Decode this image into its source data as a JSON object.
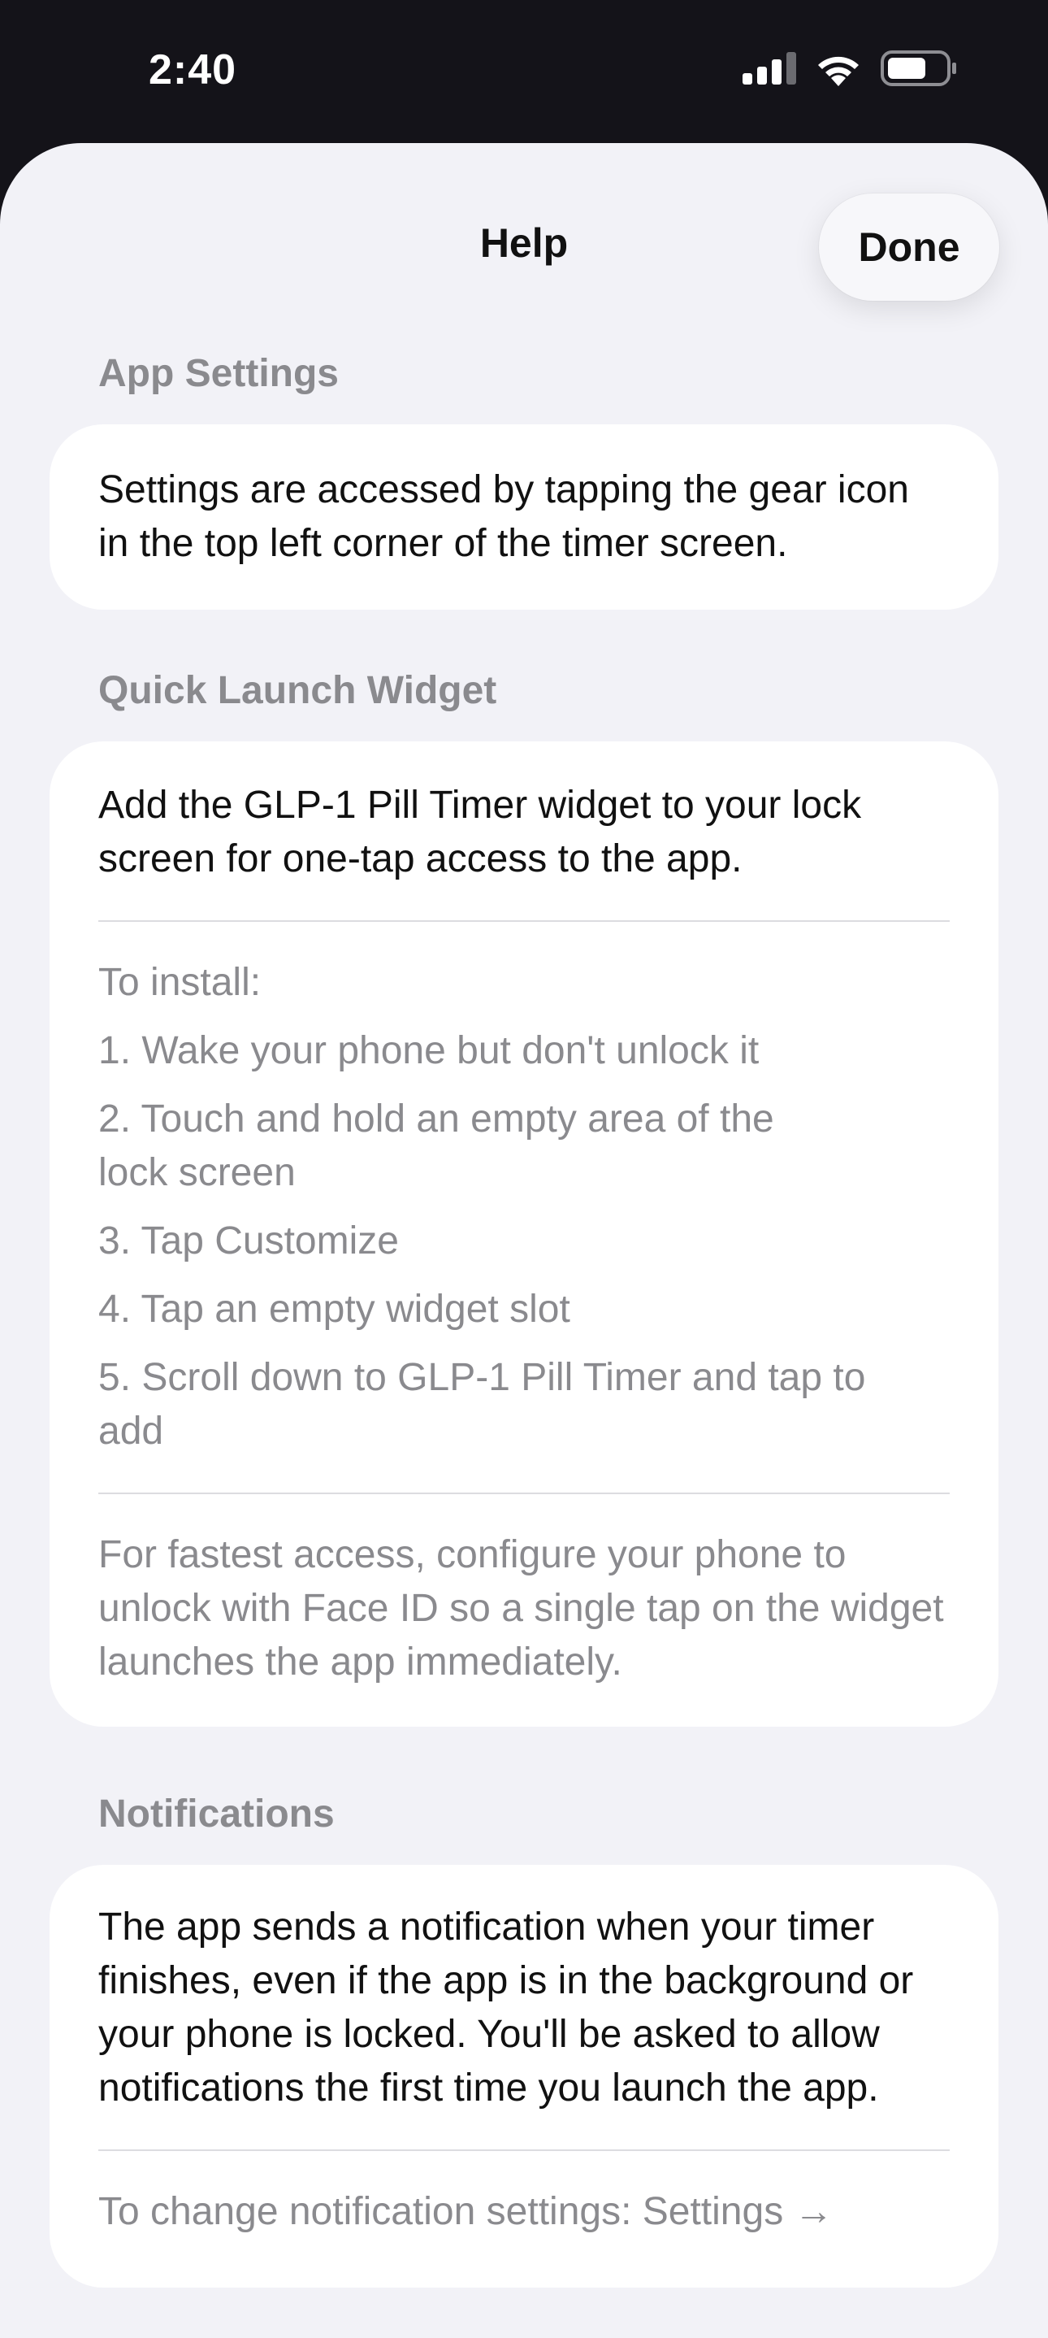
{
  "status_bar": {
    "time": "2:40"
  },
  "nav": {
    "title": "Help",
    "done_label": "Done"
  },
  "sections": {
    "app_settings": {
      "header": "App Settings",
      "body": "Settings are accessed by tapping the gear icon in the top left corner of the timer screen."
    },
    "widget": {
      "header": "Quick Launch Widget",
      "intro": "Add the GLP-1 Pill Timer widget to your lock screen for one-tap access to the app.",
      "install_label": "To install:",
      "steps": [
        "1. Wake your phone but don't unlock it",
        "2. Touch and hold an empty area of the lock screen",
        "3. Tap Customize",
        "4. Tap an empty widget slot",
        "5. Scroll down to GLP-1 Pill Timer and tap to add"
      ],
      "tip": "For fastest access, configure your phone to unlock with Face ID so a single tap on the widget launches the app immediately."
    },
    "notifications": {
      "header": "Notifications",
      "body": "The app sends a notification when your timer finishes, even if the app is in the background or your phone is locked. You'll be asked to allow notifications the first time you launch the app.",
      "settings_hint": "To change notification settings: Settings →"
    }
  }
}
